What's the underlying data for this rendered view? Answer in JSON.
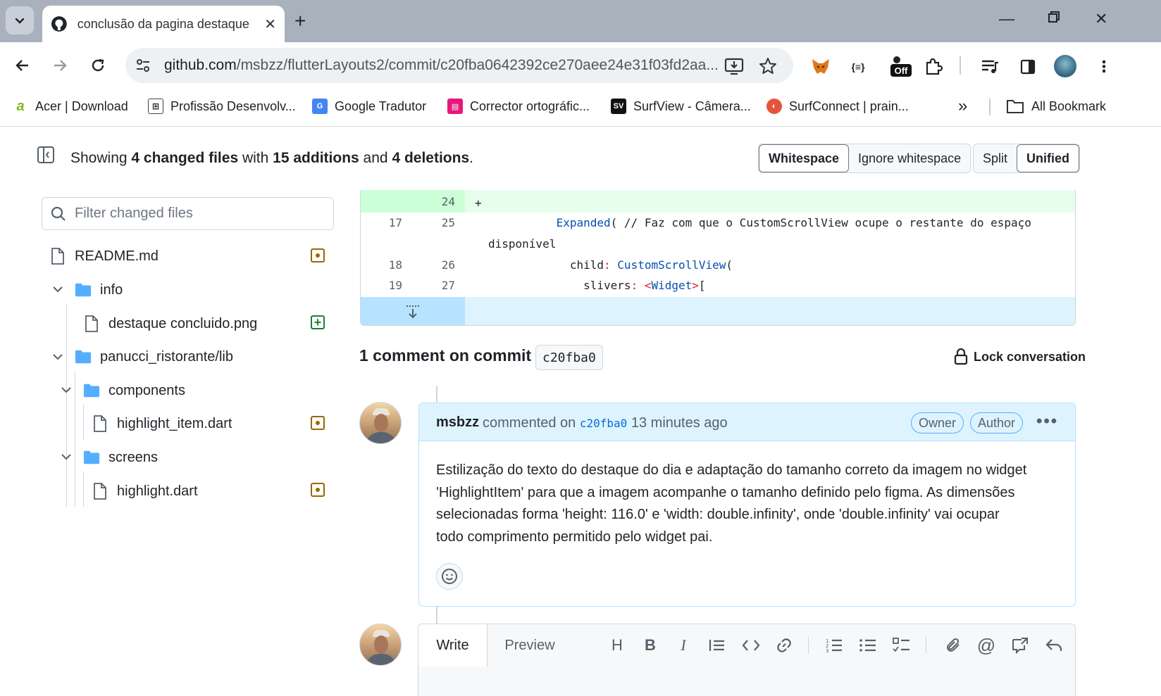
{
  "browser": {
    "tab_title": "conclusão da pagina destaque · ",
    "url_host": "github.com",
    "url_path": "/msbzz/flutterLayouts2/commit/c20fba0642392ce270aee24e31f03fd2aa...",
    "ext_json_label": "{≡}",
    "ext_off_label": "Off",
    "bookmarks": [
      {
        "label": "Acer | Download"
      },
      {
        "label": "Profissão Desenvolv..."
      },
      {
        "label": "Google Tradutor"
      },
      {
        "label": "Corrector ortográfic..."
      },
      {
        "label": "SurfView - Câmera..."
      },
      {
        "label": "SurfConnect | prain..."
      }
    ],
    "more_bookmarks": "»",
    "all_bookmarks": "All Bookmark"
  },
  "summary": {
    "showing": "Showing",
    "changed_files": "4 changed files",
    "with": "with",
    "additions": "15 additions",
    "and": "and",
    "deletions": "4 deletions",
    "period": "."
  },
  "view_options": {
    "whitespace": "Whitespace",
    "ignore_whitespace": "Ignore whitespace",
    "split": "Split",
    "unified": "Unified"
  },
  "file_filter": {
    "placeholder": "Filter changed files"
  },
  "file_tree": {
    "readme": "README.md",
    "info": "info",
    "destaque_png": "destaque concluido.png",
    "lib": "panucci_ristorante/lib",
    "components": "components",
    "highlight_item": "highlight_item.dart",
    "screens": "screens",
    "highlight": "highlight.dart"
  },
  "diff": {
    "rows": [
      {
        "old": "",
        "new": "24",
        "code_plain": "+"
      },
      {
        "old": "17",
        "new": "25"
      },
      {
        "old": "18",
        "new": "26"
      },
      {
        "old": "19",
        "new": "27"
      }
    ],
    "line25_pre": "            ",
    "line25_kw": "Expanded",
    "line25_rest": "( // Faz com que o CustomScrollView ocupe o restante do espaço",
    "line25_wrap": "disponível",
    "line26_pre": "              child",
    "line26_colon": ": ",
    "line26_kw": "CustomScrollView",
    "line26_rest": "(",
    "line27_pre": "                slivers",
    "line27_colon": ": ",
    "line27_lt": "<",
    "line27_kw": "Widget",
    "line27_gt": ">",
    "line27_rest": "["
  },
  "comments": {
    "heading": "1 comment on commit",
    "sha": "c20fba0",
    "lock": "Lock conversation"
  },
  "comment": {
    "author": "msbzz",
    "commented_on": "commented on",
    "sha": "c20fba0",
    "time": "13 minutes ago",
    "role_owner": "Owner",
    "role_author": "Author",
    "more": "•••",
    "body_1": "Estilização do texto do destaque do dia e adaptação do tamanho correto da imagem no widget",
    "body_2": "'HighlightItem' para que a imagem acompanhe o tamanho definido pelo figma. As dimensões",
    "body_3": "selecionadas forma 'height: 116.0' e 'width: double.infinity', onde 'double.infinity' vai ocupar",
    "body_4": "todo comprimento permitido pelo widget pai."
  },
  "editor": {
    "write": "Write",
    "preview": "Preview",
    "heading_tool": "H",
    "bold_tool": "B",
    "italic_tool": "I"
  },
  "colors": {
    "added_bg": "#e6ffec",
    "added_num_bg": "#ccffd8",
    "expand_bg": "#ddf4ff",
    "comment_header": "#ddf4ff",
    "modified": "#9a6700",
    "added": "#1a7f37",
    "folder": "#54aeff"
  }
}
